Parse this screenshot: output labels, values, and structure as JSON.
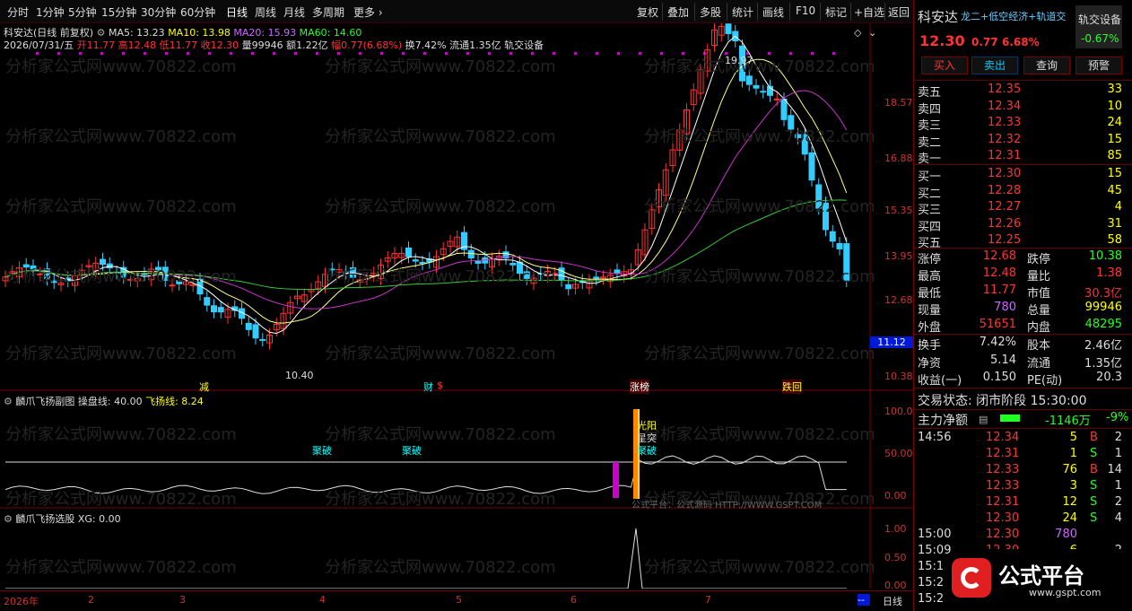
{
  "topbar": {
    "items": [
      "分时",
      "1分钟",
      "5分钟",
      "15分钟",
      "30分钟",
      "60分钟",
      "日线",
      "周线",
      "月线",
      "多周期",
      "更多"
    ],
    "right": [
      "复权",
      "叠加",
      "多股",
      "统计",
      "画线",
      "F10",
      "标记",
      "+自选",
      "返回"
    ]
  },
  "main": {
    "title": "科安达(日线 前复权)",
    "ma5": "MA5: 13.23",
    "ma10": "MA10: 13.98",
    "ma20": "MA20: 15.93",
    "ma60": "MA60: 14.60",
    "date": "2026/07/31/五",
    "open": "开11.77",
    "high": "高12.48",
    "low": "低11.77",
    "close": "收12.30",
    "vol": "量99946",
    "amt": "额1.22亿",
    "chg": "幅0.77(6.68%)",
    "turn": "换7.42%",
    "float": "流通1.35亿",
    "concept": "轨交设备",
    "peak": "19.97",
    "trough": "10.40",
    "yticks": [
      "18.57",
      "16.88",
      "15.35",
      "13.95",
      "12.68",
      "11.12",
      "10.38"
    ],
    "markers": [
      "减",
      "财",
      "涨榜",
      "跌回"
    ]
  },
  "sub1": {
    "title": "麟爪飞扬副图",
    "p1": "操盘线: 40.00",
    "p2": "飞扬线: 8.24",
    "yticks": [
      "100.0",
      "50.00",
      "0.00"
    ],
    "labels": [
      "聚破",
      "聚破",
      "光阳",
      "星突",
      "聚破"
    ],
    "src": "公式平台：公式源码 HTTP://WWW.GSPT.COM"
  },
  "sub2": {
    "title": "麟爪飞扬选股",
    "p1": "XG: 0.00",
    "yticks": [
      "1.00",
      "0.50",
      "0.00"
    ]
  },
  "xaxis": {
    "labels": [
      "2026年",
      "2",
      "3",
      "4",
      "5",
      "6",
      "7"
    ],
    "period": "日线"
  },
  "watermark": "分析家公式网www.70822.com",
  "right": {
    "name": "科安达",
    "tags": "龙二+低空经济+轨道交",
    "sector": "轨交设备",
    "sector_chg": "-0.67%",
    "price": "12.30",
    "chg": "0.77",
    "pct": "6.68%",
    "buttons": [
      "买入",
      "卖出",
      "查询",
      "预警"
    ],
    "asks": [
      [
        "卖五",
        "12.35",
        "33"
      ],
      [
        "卖四",
        "12.34",
        "10"
      ],
      [
        "卖三",
        "12.33",
        "24"
      ],
      [
        "卖二",
        "12.32",
        "15"
      ],
      [
        "卖一",
        "12.31",
        "85"
      ]
    ],
    "bids": [
      [
        "买一",
        "12.30",
        "15"
      ],
      [
        "买二",
        "12.28",
        "45"
      ],
      [
        "买三",
        "12.27",
        "4"
      ],
      [
        "买四",
        "12.26",
        "31"
      ],
      [
        "买五",
        "12.25",
        "58"
      ]
    ],
    "stats": [
      [
        "涨停",
        "12.68",
        "跌停",
        "10.38"
      ],
      [
        "最高",
        "12.48",
        "量比",
        "1.38"
      ],
      [
        "最低",
        "11.77",
        "市值",
        "30.3亿"
      ],
      [
        "现量",
        "780",
        "总量",
        "99946"
      ],
      [
        "外盘",
        "51651",
        "内盘",
        "48295"
      ]
    ],
    "fin": [
      [
        "换手",
        "7.42%",
        "股本",
        "2.46亿"
      ],
      [
        "净资",
        "5.14",
        "流通",
        "1.35亿"
      ],
      [
        "收益(一)",
        "0.150",
        "PE(动)",
        "20.3"
      ]
    ],
    "status": "交易状态: 闭市阶段 15:30:00",
    "flow_label": "主力净额",
    "flow_val": "-1146万",
    "flow_pct": "-9%",
    "ticks": [
      [
        "14:56",
        "12.34",
        "5",
        "B",
        "2"
      ],
      [
        "",
        "12.31",
        "1",
        "S",
        "1"
      ],
      [
        "",
        "12.33",
        "76",
        "B",
        "14"
      ],
      [
        "",
        "12.33",
        "3",
        "S",
        "1"
      ],
      [
        "",
        "12.31",
        "12",
        "S",
        "2"
      ],
      [
        "",
        "12.30",
        "24",
        "S",
        "4"
      ],
      [
        "15:00",
        "12.30",
        "780",
        "",
        ""
      ],
      [
        "15:09",
        "12.30",
        "6",
        "",
        "2"
      ],
      [
        "15:1",
        "",
        "",
        "",
        ""
      ],
      [
        "15:2",
        "",
        "",
        "",
        ""
      ],
      [
        "15:2",
        "",
        "",
        "",
        ""
      ]
    ],
    "logo": "公式平台",
    "logo_url": "www.gspt.com"
  }
}
